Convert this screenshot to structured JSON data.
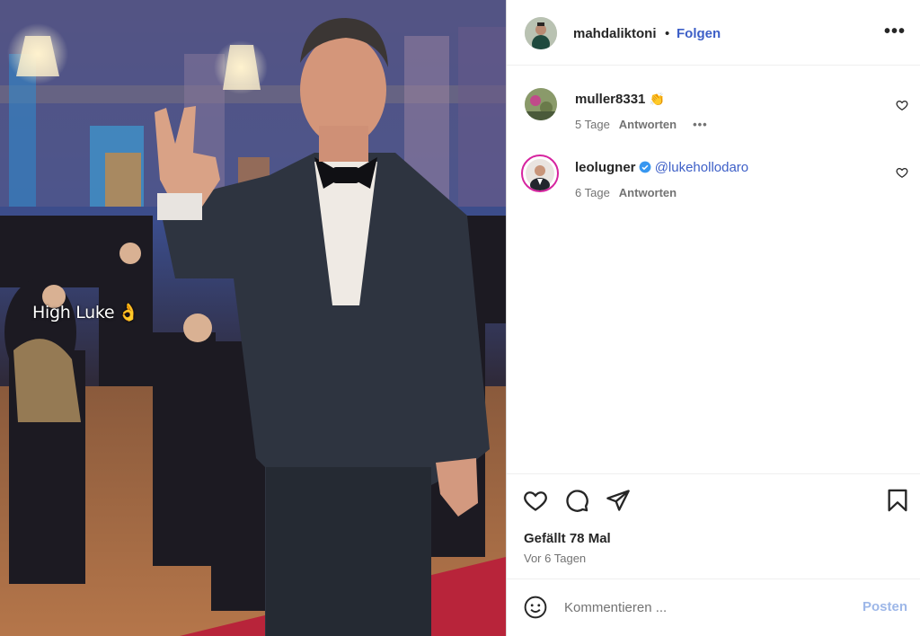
{
  "photo": {
    "caption_text": "High Luke",
    "caption_emoji": "👌"
  },
  "post": {
    "author": "mahdaliktoni",
    "separator": "•",
    "follow_label": "Folgen",
    "more_label": "•••"
  },
  "comments": [
    {
      "user": "muller8331",
      "text": "👏",
      "time": "5 Tage",
      "reply_label": "Antworten",
      "options_label": "•••"
    },
    {
      "user": "leolugner",
      "verified": true,
      "mention": "@lukehollodaro",
      "time": "6 Tage",
      "reply_label": "Antworten"
    }
  ],
  "actions": {
    "likes_text": "Gefällt 78 Mal",
    "date_text": "Vor 6 Tagen"
  },
  "composer": {
    "placeholder": "Kommentieren ...",
    "post_label": "Posten"
  },
  "colors": {
    "link_blue": "#3d5fc7",
    "post_disabled": "#9db7e8",
    "muted": "#737373"
  },
  "icons": [
    "heart-icon",
    "comment-icon",
    "share-icon",
    "bookmark-icon",
    "emoji-icon",
    "verified-icon",
    "more-icon"
  ]
}
